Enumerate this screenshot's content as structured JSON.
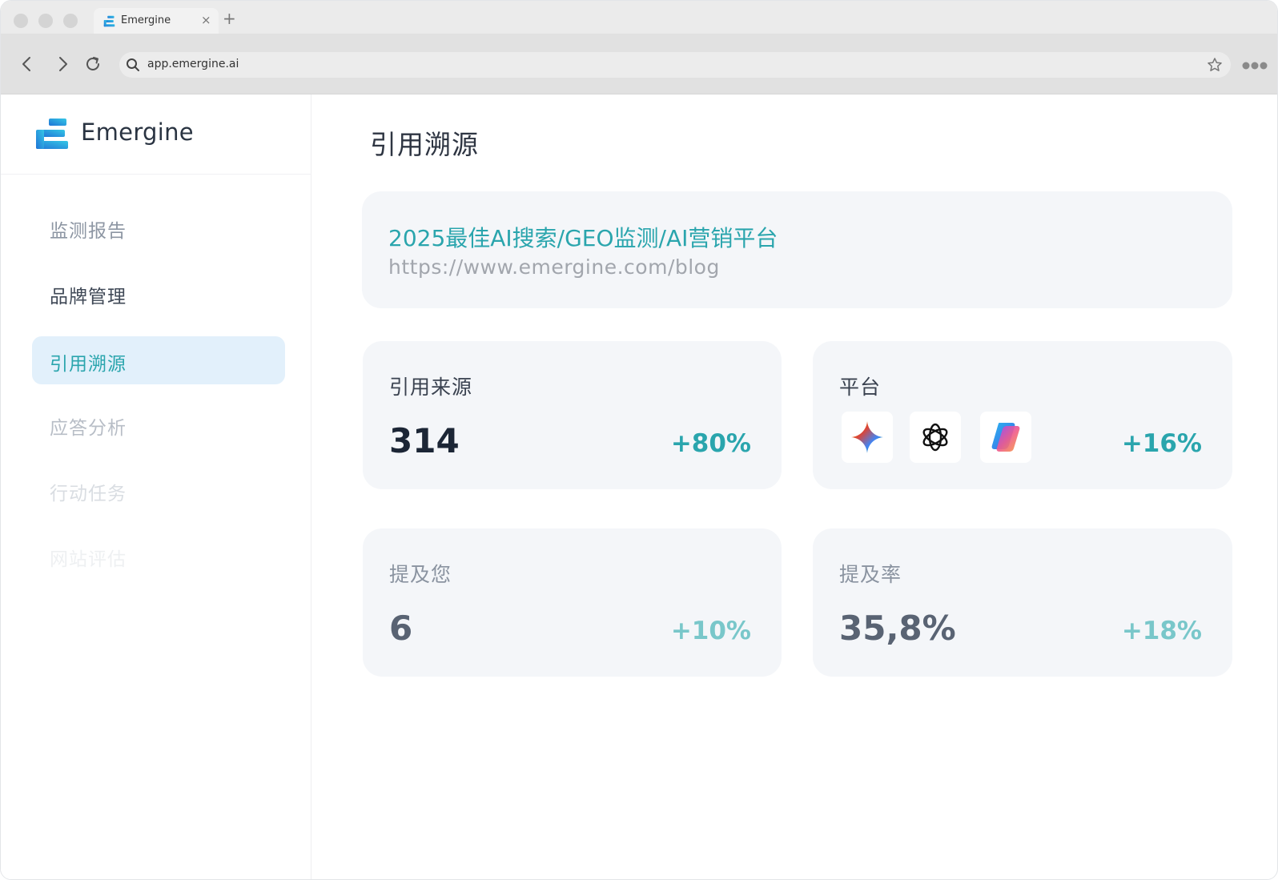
{
  "browser": {
    "tab_title": "Emergine",
    "tab_close": "×",
    "new_tab": "+",
    "url": "app.emergine.ai"
  },
  "brand": {
    "name": "Emergine"
  },
  "sidebar": {
    "items": [
      {
        "label": "监测报告",
        "color": "#8d96a3"
      },
      {
        "label": "品牌管理",
        "color": "#3f4856"
      },
      {
        "label": "引用溯源",
        "color": "#2aa5ad",
        "active": true
      },
      {
        "label": "应答分析",
        "color": "#b7bdc6"
      },
      {
        "label": "行动任务",
        "color": "#d9dde2"
      },
      {
        "label": "网站评估",
        "color": "#eef0f2"
      }
    ]
  },
  "main": {
    "page_title": "引用溯源",
    "reference": {
      "title": "2025最佳AI搜索/GEO监测/AI营销平台",
      "url": "https://www.emergine.com/blog"
    },
    "stats": [
      {
        "label": "引用来源",
        "value": "314",
        "change": "+80%"
      },
      {
        "label": "平台",
        "change": "+16%",
        "platforms": [
          "gemini-icon",
          "openai-icon",
          "copilot-icon"
        ]
      },
      {
        "label": "提及您",
        "value": "6",
        "change": "+10%"
      },
      {
        "label": "提及率",
        "value": "35,8%",
        "change": "+18%"
      }
    ]
  },
  "colors": {
    "accent": "#2aa5ad",
    "active_bg": "#e2f0fb",
    "card_bg": "#f4f6f9"
  }
}
